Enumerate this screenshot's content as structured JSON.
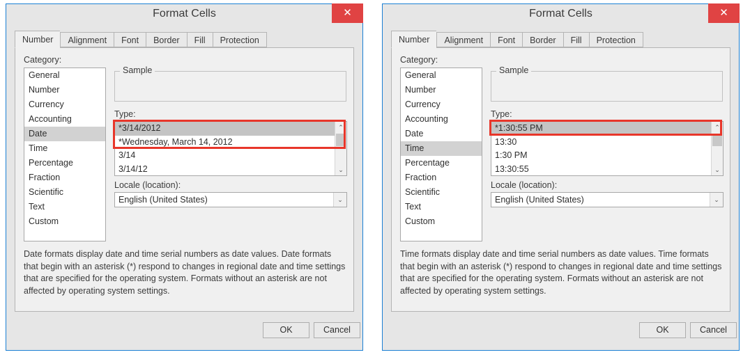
{
  "colors": {
    "dialog_border": "#1a7fd4",
    "close_button": "#e04343",
    "annotation": "#e8362a",
    "selection": "#c4c4c4",
    "dialog_bg": "#e6e6e6"
  },
  "icons": {
    "close": "✕",
    "scroll_up": "⌃",
    "scroll_down": "⌄",
    "combo_down": "⌄"
  },
  "dialogs": [
    {
      "id": "date",
      "title": "Format Cells",
      "close_label": "Close",
      "tabs": [
        {
          "label": "Number",
          "active": true
        },
        {
          "label": "Alignment",
          "active": false
        },
        {
          "label": "Font",
          "active": false
        },
        {
          "label": "Border",
          "active": false
        },
        {
          "label": "Fill",
          "active": false
        },
        {
          "label": "Protection",
          "active": false
        }
      ],
      "category_label": "Category:",
      "categories": [
        "General",
        "Number",
        "Currency",
        "Accounting",
        "Date",
        "Time",
        "Percentage",
        "Fraction",
        "Scientific",
        "Text",
        "Custom"
      ],
      "selected_category": "Date",
      "sample_label": "Sample",
      "sample_value": "",
      "type_label": "Type:",
      "types": [
        "*3/14/2012",
        "*Wednesday, March 14, 2012",
        "3/14",
        "3/14/12"
      ],
      "selected_type": "*3/14/2012",
      "locale_label": "Locale (location):",
      "locale_value": "English (United States)",
      "description": "Date formats display date and time serial numbers as date values. Date formats that begin with an asterisk (*) respond to changes in regional date and time settings that are specified for the operating system. Formats without an asterisk are not affected by operating system settings.",
      "ok_label": "OK",
      "cancel_label": "Cancel",
      "annotation_rows": 2
    },
    {
      "id": "time",
      "title": "Format Cells",
      "close_label": "Close",
      "tabs": [
        {
          "label": "Number",
          "active": true
        },
        {
          "label": "Alignment",
          "active": false
        },
        {
          "label": "Font",
          "active": false
        },
        {
          "label": "Border",
          "active": false
        },
        {
          "label": "Fill",
          "active": false
        },
        {
          "label": "Protection",
          "active": false
        }
      ],
      "category_label": "Category:",
      "categories": [
        "General",
        "Number",
        "Currency",
        "Accounting",
        "Date",
        "Time",
        "Percentage",
        "Fraction",
        "Scientific",
        "Text",
        "Custom"
      ],
      "selected_category": "Time",
      "sample_label": "Sample",
      "sample_value": "",
      "type_label": "Type:",
      "types": [
        "*1:30:55 PM",
        "13:30",
        "1:30 PM",
        "13:30:55"
      ],
      "selected_type": "*1:30:55 PM",
      "locale_label": "Locale (location):",
      "locale_value": "English (United States)",
      "description": "Time formats display date and time serial numbers as date values. Time formats that begin with an asterisk (*) respond to changes in regional date and time settings that are specified for the operating system. Formats without an asterisk are not affected by operating system settings.",
      "ok_label": "OK",
      "cancel_label": "Cancel",
      "annotation_rows": 1
    }
  ]
}
